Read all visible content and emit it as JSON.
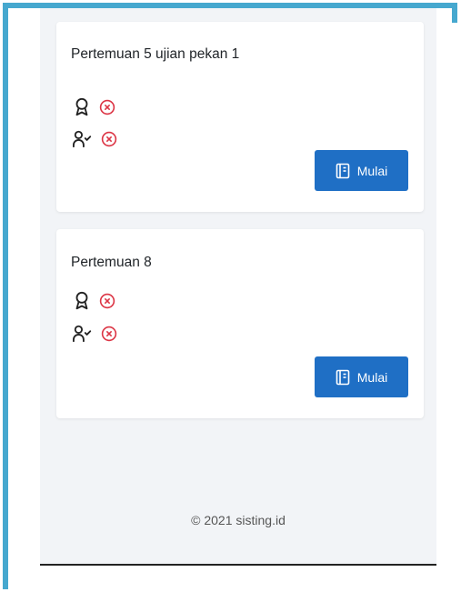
{
  "cards": [
    {
      "title": "Pertemuan 5 ujian pekan 1",
      "rows": [
        {
          "icon": "award-icon",
          "status": "not-completed"
        },
        {
          "icon": "user-check-icon",
          "status": "not-completed"
        }
      ],
      "button_label": "Mulai"
    },
    {
      "title": "Pertemuan 8",
      "rows": [
        {
          "icon": "award-icon",
          "status": "not-completed"
        },
        {
          "icon": "user-check-icon",
          "status": "not-completed"
        }
      ],
      "button_label": "Mulai"
    }
  ],
  "footer": {
    "text": "© 2021 sisting.id"
  },
  "colors": {
    "primary": "#1f6fc5",
    "danger": "#dc3545",
    "frame": "#46a8cf",
    "background": "#f2f4f7"
  }
}
